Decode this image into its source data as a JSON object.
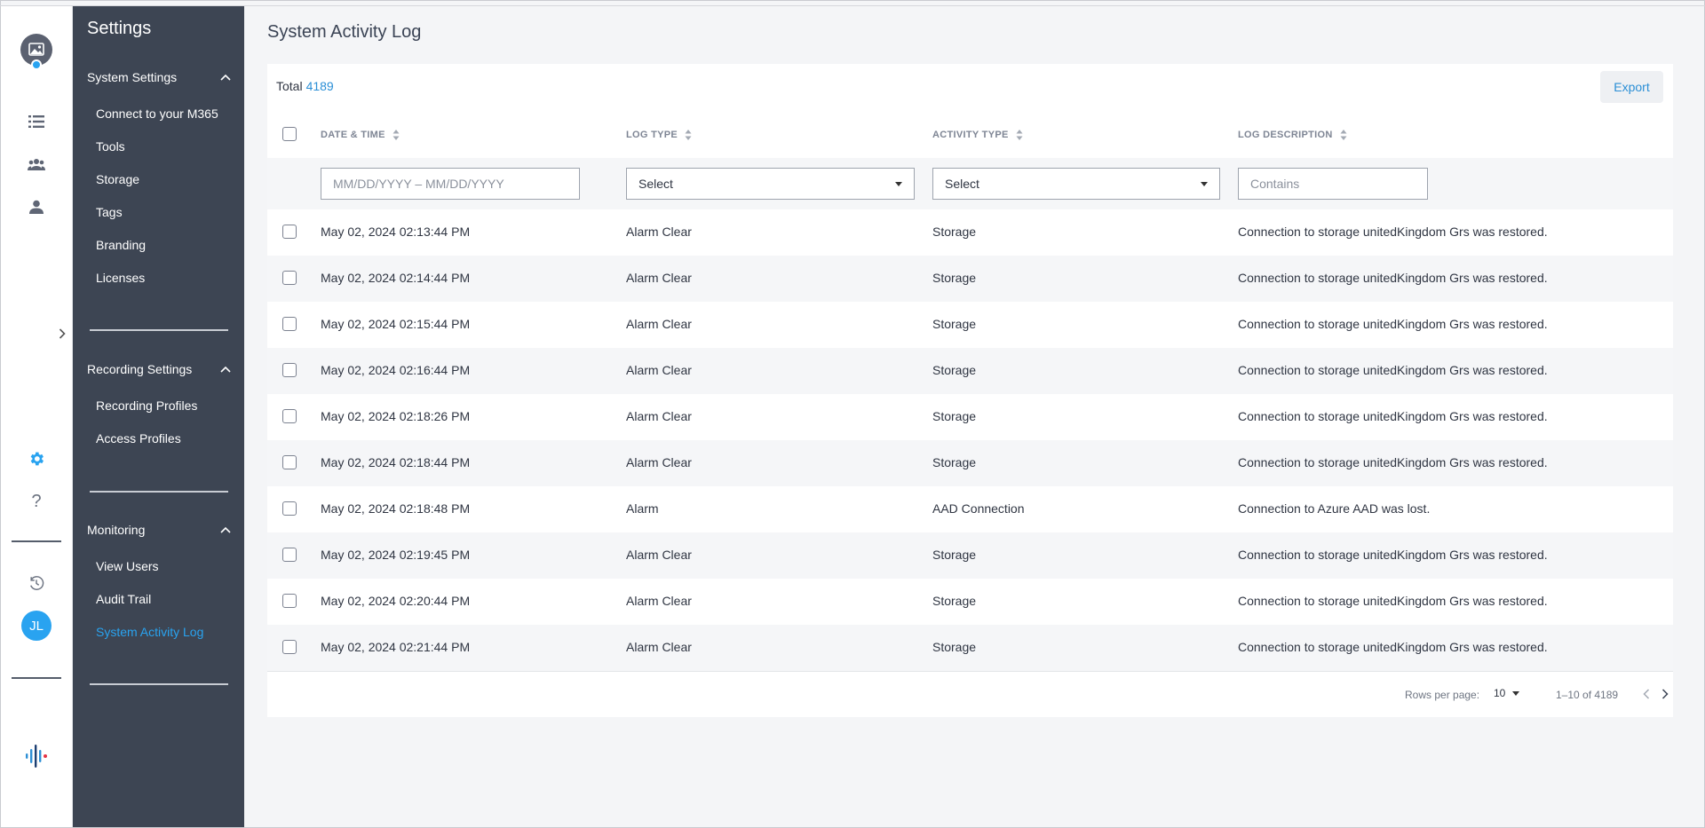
{
  "sidebar": {
    "title": "Settings",
    "groups": [
      {
        "label": "System Settings",
        "items": [
          "Connect to your M365",
          "Tools",
          "Storage",
          "Tags",
          "Branding",
          "Licenses"
        ]
      },
      {
        "label": "Recording Settings",
        "items": [
          "Recording Profiles",
          "Access Profiles"
        ]
      },
      {
        "label": "Monitoring",
        "items": [
          "View Users",
          "Audit Trail",
          "System Activity Log"
        ]
      }
    ],
    "active_item": "System Activity Log"
  },
  "rail": {
    "avatar_initials": "JL",
    "icons": [
      "image-icon",
      "list-icon",
      "group-icon",
      "person-icon",
      "gear-icon",
      "help-icon",
      "history-icon",
      "brand-logo"
    ],
    "accent_color": "#29a3f0"
  },
  "page": {
    "title": "System Activity Log"
  },
  "summary": {
    "total_label": "Total",
    "total_value": "4189",
    "export_label": "Export"
  },
  "table": {
    "columns": [
      "DATE & TIME",
      "LOG TYPE",
      "ACTIVITY TYPE",
      "LOG DESCRIPTION"
    ],
    "filters": {
      "date_placeholder": "MM/DD/YYYY – MM/DD/YYYY",
      "log_type_value": "Select",
      "activity_type_value": "Select",
      "description_placeholder": "Contains"
    },
    "rows": [
      {
        "datetime": "May 02, 2024 02:13:44 PM",
        "log_type": "Alarm Clear",
        "activity": "Storage",
        "description": "Connection to storage unitedKingdom Grs was restored."
      },
      {
        "datetime": "May 02, 2024 02:14:44 PM",
        "log_type": "Alarm Clear",
        "activity": "Storage",
        "description": "Connection to storage unitedKingdom Grs was restored."
      },
      {
        "datetime": "May 02, 2024 02:15:44 PM",
        "log_type": "Alarm Clear",
        "activity": "Storage",
        "description": "Connection to storage unitedKingdom Grs was restored."
      },
      {
        "datetime": "May 02, 2024 02:16:44 PM",
        "log_type": "Alarm Clear",
        "activity": "Storage",
        "description": "Connection to storage unitedKingdom Grs was restored."
      },
      {
        "datetime": "May 02, 2024 02:18:26 PM",
        "log_type": "Alarm Clear",
        "activity": "Storage",
        "description": "Connection to storage unitedKingdom Grs was restored."
      },
      {
        "datetime": "May 02, 2024 02:18:44 PM",
        "log_type": "Alarm Clear",
        "activity": "Storage",
        "description": "Connection to storage unitedKingdom Grs was restored."
      },
      {
        "datetime": "May 02, 2024 02:18:48 PM",
        "log_type": "Alarm",
        "activity": "AAD Connection",
        "description": "Connection to Azure AAD was lost."
      },
      {
        "datetime": "May 02, 2024 02:19:45 PM",
        "log_type": "Alarm Clear",
        "activity": "Storage",
        "description": "Connection to storage unitedKingdom Grs was restored."
      },
      {
        "datetime": "May 02, 2024 02:20:44 PM",
        "log_type": "Alarm Clear",
        "activity": "Storage",
        "description": "Connection to storage unitedKingdom Grs was restored."
      },
      {
        "datetime": "May 02, 2024 02:21:44 PM",
        "log_type": "Alarm Clear",
        "activity": "Storage",
        "description": "Connection to storage unitedKingdom Grs was restored."
      }
    ]
  },
  "pagination": {
    "rows_per_page_label": "Rows per page:",
    "rows_per_page": "10",
    "range": "1–10 of 4189"
  }
}
